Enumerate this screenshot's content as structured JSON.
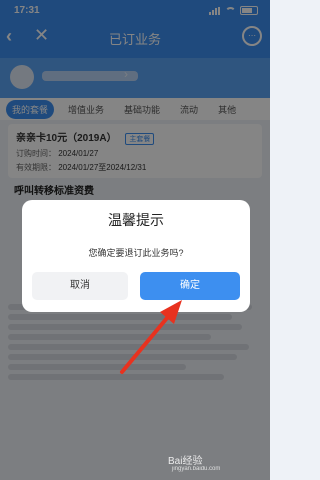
{
  "status": {
    "time": "17:31"
  },
  "nav": {
    "title": "已订业务",
    "back_icon": "‹",
    "close_icon": "✕",
    "more_icon": "⋯"
  },
  "tabs": [
    "我的套餐",
    "增值业务",
    "基础功能",
    "流动",
    "其他"
  ],
  "product": {
    "name": "亲亲卡10元（2019A）",
    "badge": "主套餐",
    "order_time_label": "订购时间：",
    "order_time": "2024/01/27",
    "valid_label": "有效期限：",
    "valid_range": "2024/01/27至2024/12/31"
  },
  "section_title": "呼叫转移标准资费",
  "dialog": {
    "title": "温馨提示",
    "message": "您确定要退订此业务吗?",
    "cancel": "取消",
    "confirm": "确定"
  },
  "colors": {
    "accent": "#3d8ff0",
    "arrow": "#e8321f"
  },
  "watermark": {
    "brand": "Bai经验",
    "url": "jingyan.baidu.com"
  }
}
